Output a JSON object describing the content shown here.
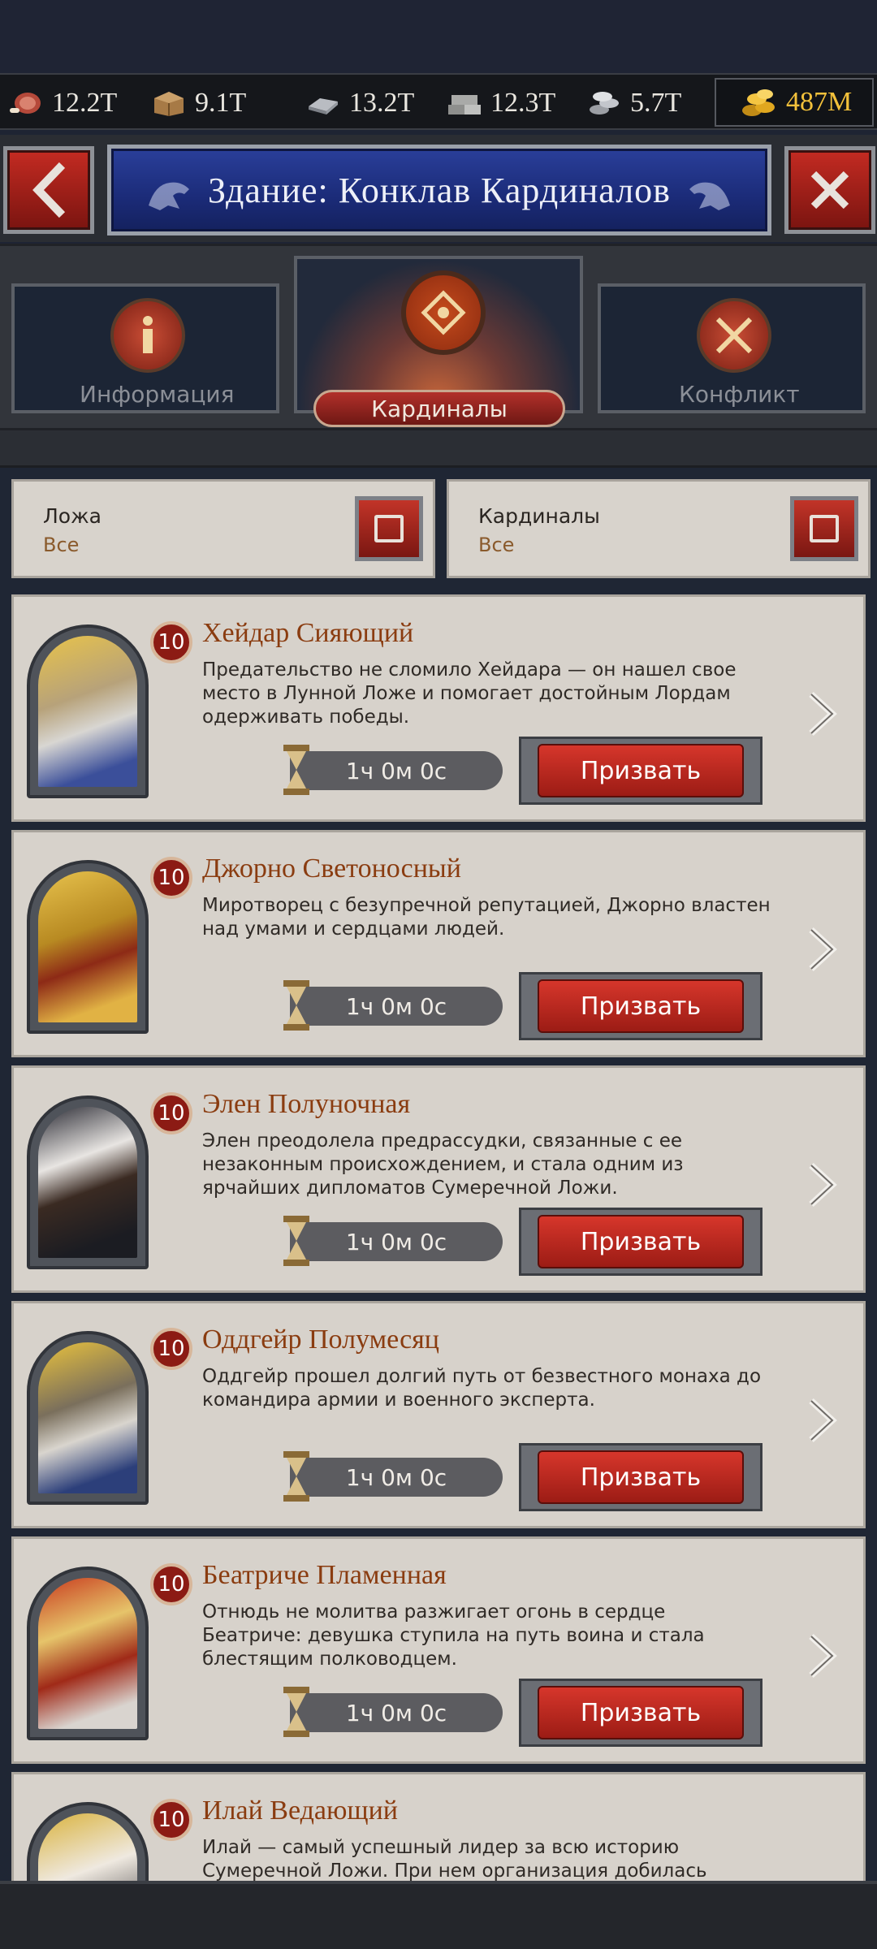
{
  "resources": [
    {
      "icon": "meat-icon",
      "value": "12.2T"
    },
    {
      "icon": "wood-icon",
      "value": "9.1T"
    },
    {
      "icon": "iron-icon",
      "value": "13.2T"
    },
    {
      "icon": "stone-icon",
      "value": "12.3T"
    },
    {
      "icon": "silver-icon",
      "value": "5.7T"
    }
  ],
  "gold": {
    "icon": "gold-coins-icon",
    "value": "487M"
  },
  "header": {
    "title": "Здание: Конклав Кардиналов"
  },
  "tabs": [
    {
      "label": "Информация",
      "icon": "info-icon"
    },
    {
      "label": "Кардиналы",
      "icon": "cardinal-seal-icon",
      "active": true
    },
    {
      "label": "Конфликт",
      "icon": "crossed-swords-icon"
    }
  ],
  "filters": [
    {
      "label": "Ложа",
      "value": "Все"
    },
    {
      "label": "Кардиналы",
      "value": "Все"
    }
  ],
  "cardinals": [
    {
      "level": "10",
      "name": "Хейдар Сияющий",
      "description": "Предательство не сломило Хейдара — он нашел свое место в Лунной Ложе и помогает достойным Лордам одерживать победы.",
      "timer": "1ч 0м 0с",
      "button": "Призвать"
    },
    {
      "level": "10",
      "name": "Джорно Светоносный",
      "description": "Миротворец с безупречной репутацией, Джорно властен над умами и сердцами людей.",
      "timer": "1ч 0м 0с",
      "button": "Призвать"
    },
    {
      "level": "10",
      "name": "Элен Полуночная",
      "description": "Элен преодолела предрассудки, связанные с ее незаконным происхождением, и стала одним из ярчайших дипломатов Сумеречной Ложи.",
      "timer": "1ч 0м 0с",
      "button": "Призвать"
    },
    {
      "level": "10",
      "name": "Оддгейр Полумесяц",
      "description": "Оддгейр прошел долгий путь от безвестного монаха до командира армии и военного эксперта.",
      "timer": "1ч 0м 0с",
      "button": "Призвать"
    },
    {
      "level": "10",
      "name": "Беатриче Пламенная",
      "description": "Отнюдь не молитва разжигает огонь в сердце Беатриче: девушка ступила на путь воина и стала блестящим полководцем.",
      "timer": "1ч 0м 0с",
      "button": "Призвать"
    },
    {
      "level": "10",
      "name": "Илай Ведающий",
      "description": "Илай — самый успешный лидер за всю историю Сумеречной Ложи. При нем организация добилась наибольшего влияния",
      "timer": "",
      "button": ""
    }
  ]
}
